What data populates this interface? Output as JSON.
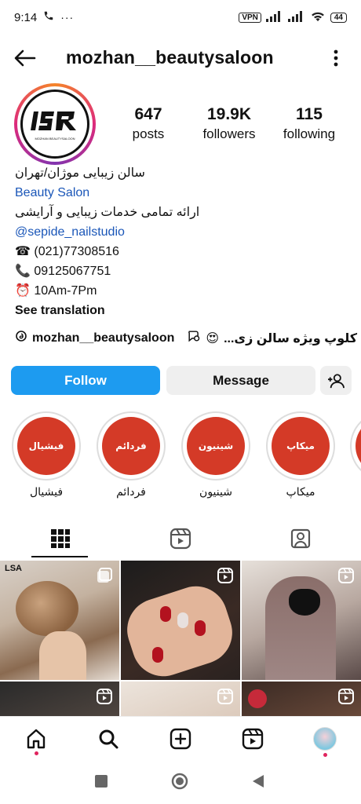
{
  "status": {
    "time": "9:14",
    "vpn": "VPN",
    "battery": "44"
  },
  "header": {
    "username": "mozhan__beautysaloon"
  },
  "stats": [
    {
      "value": "647",
      "label": "posts"
    },
    {
      "value": "19.9K",
      "label": "followers"
    },
    {
      "value": "115",
      "label": "following"
    }
  ],
  "bio": {
    "name": "سالن زیبایی موژان/تهران",
    "category": "Beauty Salon",
    "description": "ارائه تمامی خدمات زیبایی و آرایشی",
    "mention": "@sepide_nailstudio",
    "phone1": "☎ (021)77308516",
    "phone2": "📞 09125067751",
    "hours": "⏰ 10Am-7Pm",
    "see_translation": "See translation"
  },
  "threads": {
    "handle": "mozhan__beautysaloon",
    "channel": "کلوپ ویژه سالن زی...",
    "emoji": "😍"
  },
  "actions": {
    "follow": "Follow",
    "message": "Message"
  },
  "highlights": [
    {
      "title": "فیشیال",
      "label": "فیشیال"
    },
    {
      "title": "فردائم",
      "label": "فردائم"
    },
    {
      "title": "شینیون",
      "label": "شینیون"
    },
    {
      "title": "میکاپ",
      "label": "میکاپ"
    }
  ],
  "logo_text": "LSA",
  "logo_subtext": "MOZHAN BEAUTYSALOON",
  "colors": {
    "follow_blue": "#1d9bf0",
    "highlight_red": "#d43a27",
    "mention_blue": "#1a56b8",
    "notification_dot": "#e0245e"
  }
}
